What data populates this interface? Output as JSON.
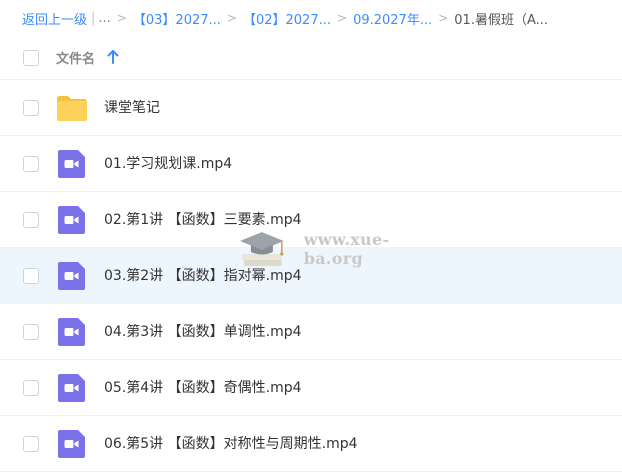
{
  "breadcrumb": {
    "back": "返回上一级",
    "pipe": "|",
    "ellipsis": "...",
    "sep": ">",
    "items": [
      "【03】2027...",
      "【02】2027...",
      "09.2027年..."
    ],
    "current": "01.暑假班（A..."
  },
  "header": {
    "column_label": "文件名",
    "sort_icon": "arrow-up-icon"
  },
  "files": [
    {
      "name": "课堂笔记",
      "type": "folder"
    },
    {
      "name": "01.学习规划课.mp4",
      "type": "video"
    },
    {
      "name": "02.第1讲 【函数】三要素.mp4",
      "type": "video"
    },
    {
      "name": "03.第2讲 【函数】指对幂.mp4",
      "type": "video"
    },
    {
      "name": "04.第3讲 【函数】单调性.mp4",
      "type": "video"
    },
    {
      "name": "05.第4讲 【函数】奇偶性.mp4",
      "type": "video"
    },
    {
      "name": "06.第5讲 【函数】对称性与周期性.mp4",
      "type": "video"
    }
  ],
  "watermark": {
    "text": "www.xue-ba.org",
    "icon": "graduation-cap-icon"
  },
  "colors": {
    "link": "#3b8cff",
    "folder": "#fdd25a",
    "video": "#7b71e8",
    "row_highlight": "#eef6fd"
  }
}
